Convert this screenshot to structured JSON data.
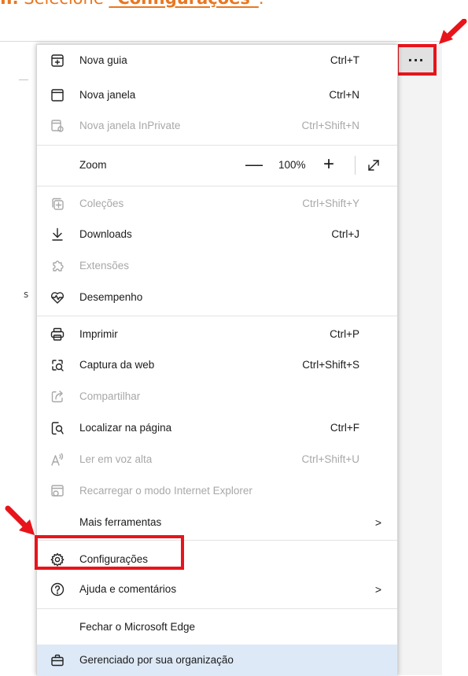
{
  "instruction": {
    "step": "II.",
    "text_before": " Selecione ",
    "keyword": "\"Configurações\"",
    "text_after": "."
  },
  "more_button": {
    "label": "···"
  },
  "edge_fragment": "s",
  "menu": {
    "items": [
      {
        "label": "Nova guia",
        "shortcut": "Ctrl+T",
        "icon": "new-tab-icon",
        "disabled": false
      },
      {
        "label": "Nova janela",
        "shortcut": "Ctrl+N",
        "icon": "new-window-icon",
        "disabled": false
      },
      {
        "label": "Nova janela InPrivate",
        "shortcut": "Ctrl+Shift+N",
        "icon": "inprivate-icon",
        "disabled": true
      },
      {
        "label": "Zoom",
        "icon": "",
        "disabled": false
      },
      {
        "label": "Coleções",
        "shortcut": "Ctrl+Shift+Y",
        "icon": "collections-icon",
        "disabled": true
      },
      {
        "label": "Downloads",
        "shortcut": "Ctrl+J",
        "icon": "download-icon",
        "disabled": false
      },
      {
        "label": "Extensões",
        "shortcut": "",
        "icon": "extensions-icon",
        "disabled": true
      },
      {
        "label": "Desempenho",
        "shortcut": "",
        "icon": "performance-icon",
        "disabled": false
      },
      {
        "label": "Imprimir",
        "shortcut": "Ctrl+P",
        "icon": "printer-icon",
        "disabled": false
      },
      {
        "label": "Captura da web",
        "shortcut": "Ctrl+Shift+S",
        "icon": "web-capture-icon",
        "disabled": false
      },
      {
        "label": "Compartilhar",
        "shortcut": "",
        "icon": "share-icon",
        "disabled": true
      },
      {
        "label": "Localizar na página",
        "shortcut": "Ctrl+F",
        "icon": "find-icon",
        "disabled": false
      },
      {
        "label": "Ler em voz alta",
        "shortcut": "Ctrl+Shift+U",
        "icon": "read-aloud-icon",
        "disabled": true
      },
      {
        "label": "Recarregar o modo Internet Explorer",
        "shortcut": "",
        "icon": "ie-mode-icon",
        "disabled": true
      },
      {
        "label": "Mais ferramentas",
        "shortcut": "",
        "icon": "",
        "disabled": false,
        "submenu": ">"
      },
      {
        "label": "Configurações",
        "shortcut": "",
        "icon": "gear-icon",
        "disabled": false
      },
      {
        "label": "Ajuda e comentários",
        "shortcut": "",
        "icon": "help-icon",
        "disabled": false,
        "submenu": ">"
      },
      {
        "label": "Fechar o Microsoft Edge",
        "shortcut": "",
        "icon": "",
        "disabled": false
      },
      {
        "label": "Gerenciado por sua organização",
        "shortcut": "",
        "icon": "briefcase-icon",
        "disabled": false
      }
    ],
    "zoom": {
      "minus": "—",
      "value": "100%",
      "plus": "+"
    }
  },
  "colors": {
    "annotation_red": "#e8141b",
    "instruction_orange": "#e87722",
    "highlight_bg": "#dde9f6",
    "disabled_text": "#a8a8a8"
  }
}
